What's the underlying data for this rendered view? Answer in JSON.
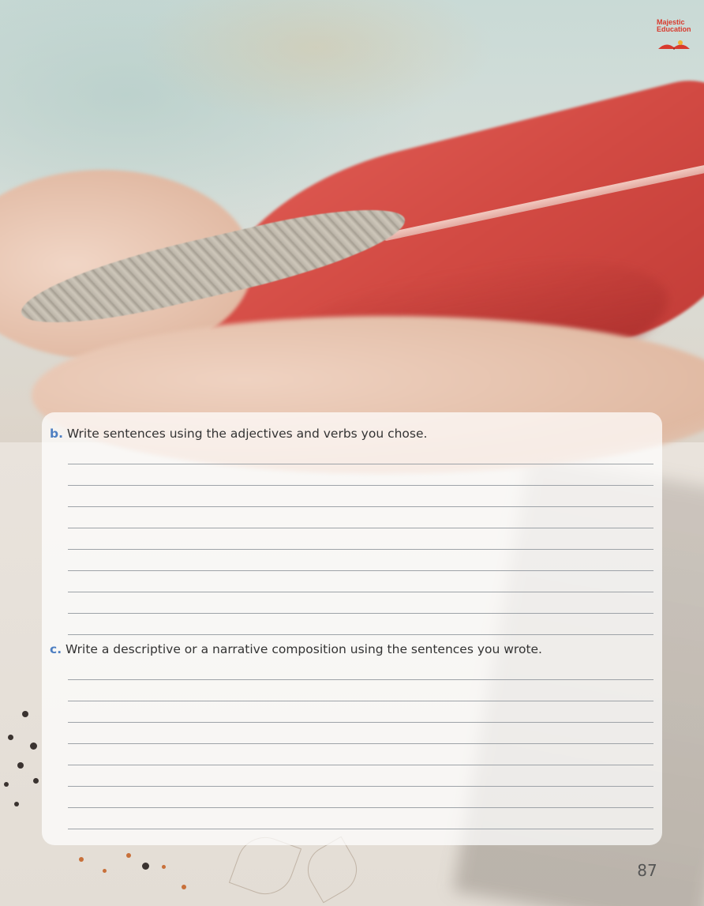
{
  "brand": {
    "logo_line1": "Majestic",
    "logo_line2": "Education"
  },
  "exercises": [
    {
      "letter": "b.",
      "prompt": "Write sentences using the adjectives and verbs you chose.",
      "writing_lines": 9
    },
    {
      "letter": "c.",
      "prompt": "Write a descriptive or a narrative composition using the sentences you wrote.",
      "writing_lines": 8
    }
  ],
  "page_number": "87",
  "colors": {
    "letter_accent": "#4e7fc2",
    "logo_red": "#d83a2d",
    "card_background": "rgba(255,255,255,0.72)"
  }
}
